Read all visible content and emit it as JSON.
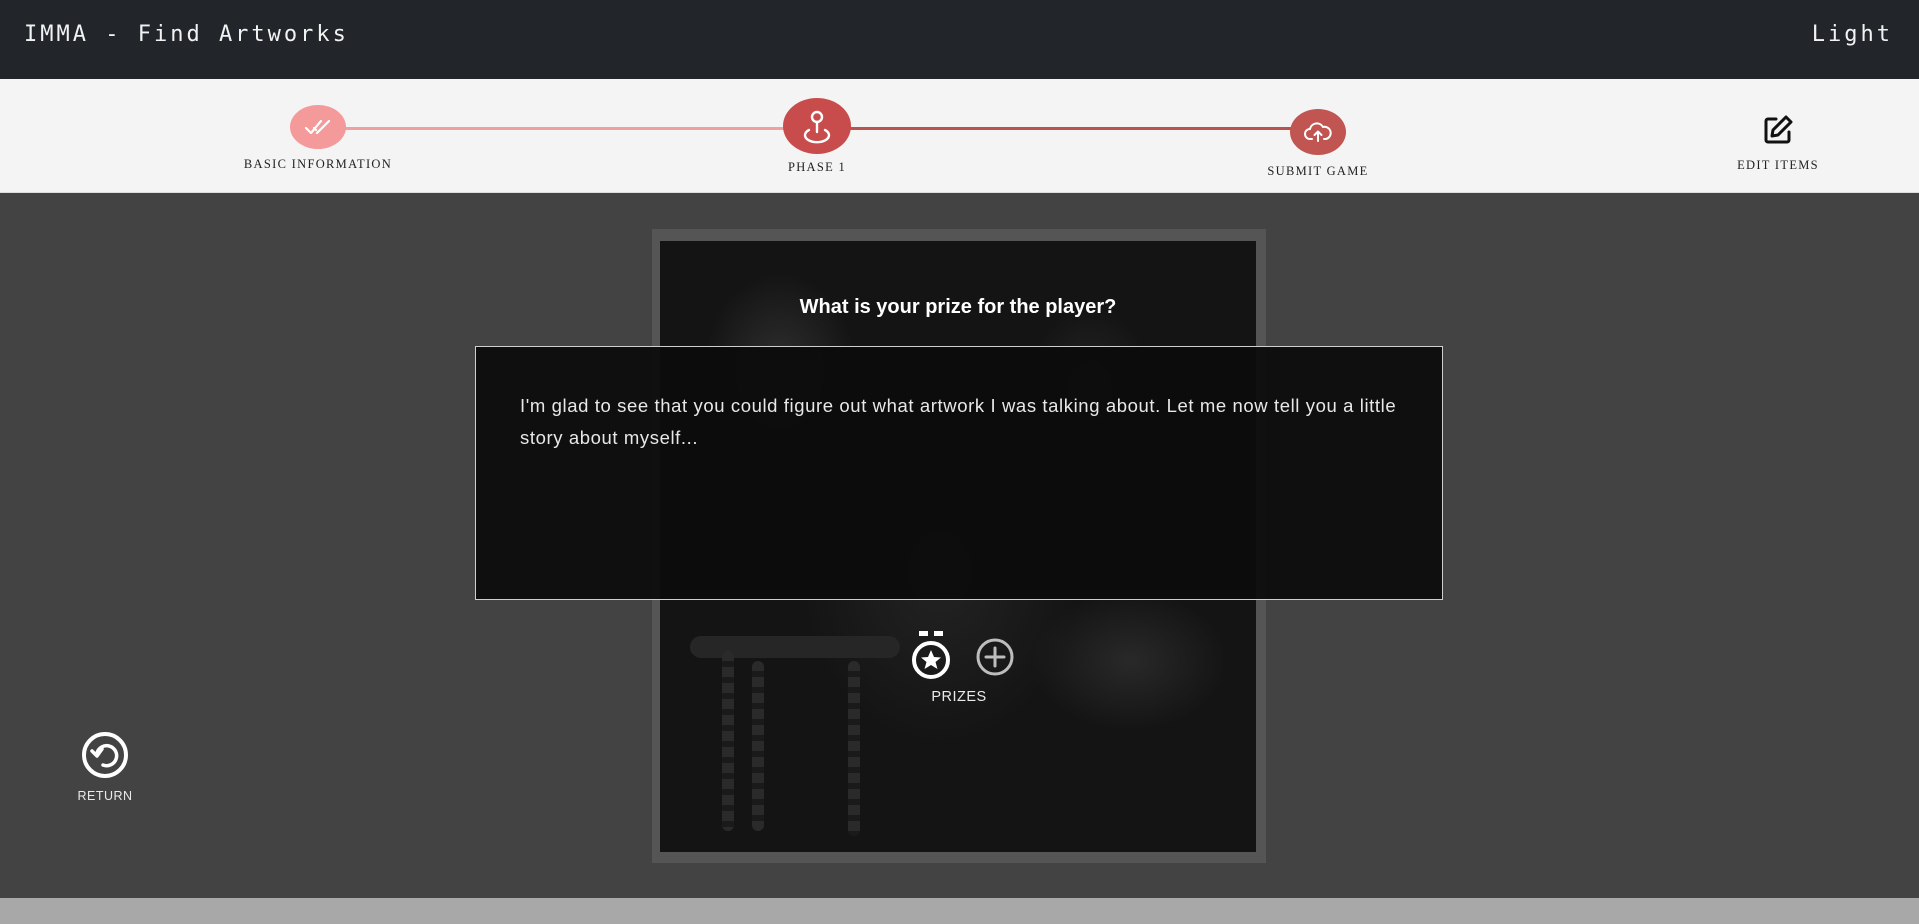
{
  "header": {
    "title": "IMMA - Find Artworks",
    "theme_toggle": "Light"
  },
  "stepper": {
    "steps": [
      {
        "label": "BASIC INFORMATION",
        "icon": "double-check-icon",
        "status": "completed",
        "color": "#f49a9a"
      },
      {
        "label": "PHASE 1",
        "icon": "map-pin-icon",
        "status": "current",
        "color": "#c94c4c"
      },
      {
        "label": "SUBMIT GAME",
        "icon": "cloud-upload-icon",
        "status": "upcoming",
        "color": "#c05552"
      }
    ],
    "edit_items": {
      "label": "EDIT ITEMS",
      "icon": "edit-icon"
    }
  },
  "card": {
    "question": "What is your prize for the player?",
    "message": "I'm glad to see that you could figure out what artwork I was talking about. Let me now tell you a little story about myself...",
    "prizes_label": "PRIZES",
    "prize_icon": "medal-icon",
    "add_icon": "plus-circle-icon"
  },
  "return": {
    "label": "RETURN",
    "icon": "undo-icon"
  },
  "colors": {
    "header_bg": "#22252a",
    "stepper_bg": "#f4f4f4",
    "page_bg": "#434343",
    "accent_light": "#f49a9a",
    "accent": "#c94c4c"
  }
}
